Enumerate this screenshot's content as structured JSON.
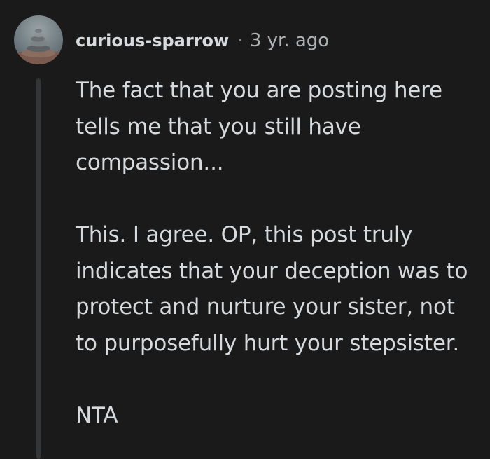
{
  "comment": {
    "username": "curious-sparrow",
    "separator": "·",
    "timestamp": "3 yr. ago",
    "avatar_icon": "stacked-stones-avatar-icon",
    "paragraphs": [
      "The fact that you are posting here tells me that you still have compassion...",
      "This. I agree. OP, this post truly indicates that your deception was to protect and nurture your sister, not to purposefully hurt your stepsister.",
      "NTA"
    ]
  },
  "colors": {
    "background": "#1a1a1b",
    "text": "#d7dadc",
    "meta_text": "#b0b3b5",
    "thread_line": "#343536"
  }
}
